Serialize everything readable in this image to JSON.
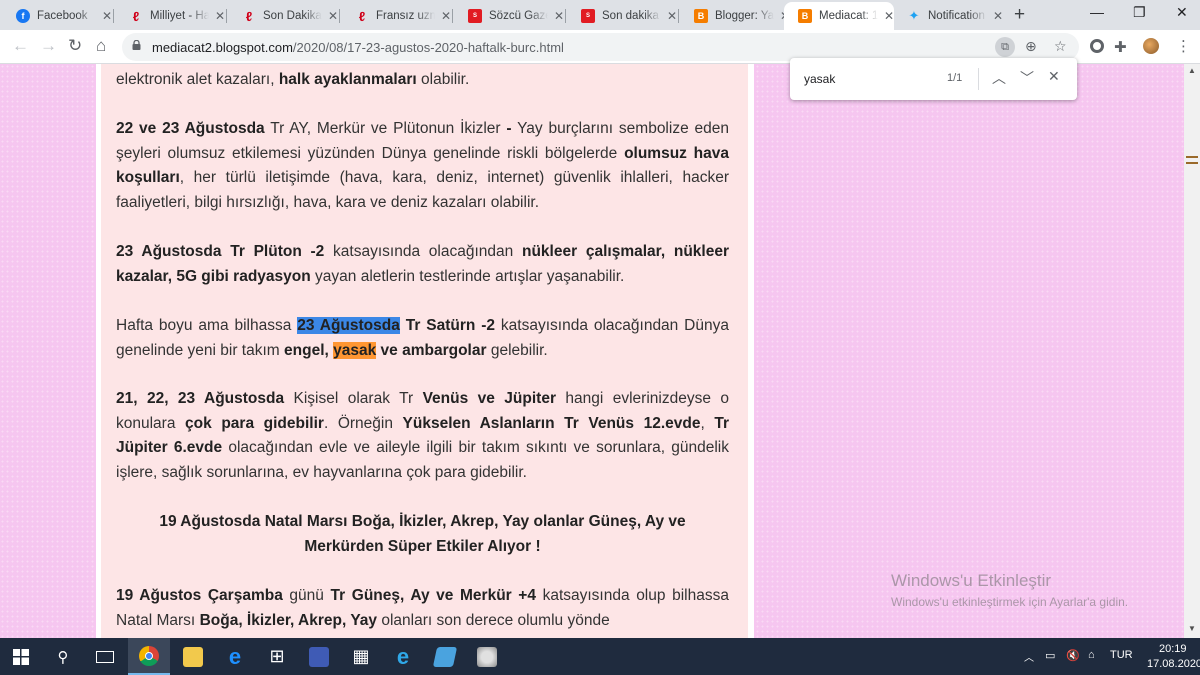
{
  "browser": {
    "tabs": [
      {
        "label": "Facebook",
        "favicon": "facebook-icon",
        "color": "#1877f2"
      },
      {
        "label": "Milliyet - Ha",
        "favicon": "milliyet-icon",
        "color": "#d0021b"
      },
      {
        "label": "Son Dakika",
        "favicon": "milliyet-icon",
        "color": "#d0021b"
      },
      {
        "label": "Fransız uzm",
        "favicon": "milliyet-icon",
        "color": "#d0021b"
      },
      {
        "label": "Sözcü Gaze",
        "favicon": "sozcu-icon",
        "color": "#e11b22"
      },
      {
        "label": "Son dakika",
        "favicon": "sozcu-icon",
        "color": "#e11b22"
      },
      {
        "label": "Blogger: Ya",
        "favicon": "blogger-icon",
        "color": "#f57d00"
      },
      {
        "label": "Mediacat: 1",
        "favicon": "blogger-icon",
        "color": "#f57d00",
        "active": true
      },
      {
        "label": "Notification",
        "favicon": "twitter-icon",
        "color": "#1da1f2"
      }
    ],
    "address": {
      "host": "mediacat2.blogspot.com",
      "path": "/2020/08/17-23-agustos-2020-haftalk-burc.html"
    },
    "find": {
      "query": "yasak",
      "count": "1/1"
    }
  },
  "post": {
    "p0": {
      "line": "elektronik alet kazaları, ",
      "bold": "halk ayaklanmaları",
      "tail": " olabilir."
    },
    "p1": {
      "b1": "22 ve 23 Ağustosda",
      "t1": " Tr AY, Merkür ve Plütonun İkizler ",
      "b2": "-",
      "t2": " Yay burçlarını sembolize eden şeyleri olumsuz etkilemesi yüzünden Dünya genelinde riskli bölgelerde ",
      "b3": "olumsuz hava koşulları",
      "t3": ", her türlü iletişimde (hava, kara, deniz, internet) güvenlik ihlalleri, hacker faaliyetleri, bilgi hırsızlığı, hava, kara ve deniz kazaları olabilir."
    },
    "p2": {
      "b1": "23 Ağustosda Tr Plüton -2",
      "t1": " katsayısında olacağından ",
      "b2": "nükleer çalışmalar, nükleer kazalar, 5G gibi radyasyon",
      "t2": " yayan aletlerin testlerinde artışlar yaşanabilir."
    },
    "p3": {
      "t1": "Hafta boyu ama bilhassa ",
      "sel": "23 Ağustosda",
      "t2": " ",
      "b1": "Tr Satürn -2",
      "t3": " katsayısında olacağından Dünya genelinde yeni bir takım ",
      "b2": "engel, ",
      "find": "yasak",
      "b3": " ve ambargolar",
      "t4": " gelebilir."
    },
    "p4": {
      "b1": "21, 22, 23 Ağustosda",
      "t1": " Kişisel olarak Tr ",
      "b2": "Venüs ve Jüpiter",
      "t2": " hangi evlerinizdeyse o konulara ",
      "b3": "çok para gidebilir",
      "t3": ". Örneğin ",
      "b4": "Yükselen Aslanların Tr Venüs 12.evde",
      "t4": ", ",
      "b5": "Tr Jüpiter 6.evde",
      "t5": " olacağından evle ve aileyle ilgili bir takım sıkıntı ve sorunlara, gündelik işlere, sağlık sorunlarına, ev hayvanlarına çok para gidebilir."
    },
    "p5": {
      "heading": "19 Ağustosda Natal Marsı Boğa, İkizler, Akrep, Yay olanlar Güneş, Ay ve Merkürden Süper Etkiler Alıyor !"
    },
    "p6": {
      "b1": "19 Ağustos Çarşamba",
      "t1": " günü ",
      "b2": "Tr Güneş, Ay ve Merkür +4",
      "t2": " katsayısında olup bilhassa Natal Marsı ",
      "b3": "Boğa, İkizler, Akrep, Yay",
      "t3": " olanları son derece olumlu yönde"
    }
  },
  "watermark": {
    "title": "Windows'u Etkinleştir",
    "subtitle": "Windows'u etkinleştirmek için Ayarlar'a gidin."
  },
  "taskbar": {
    "lang": "TUR",
    "time": "20:19",
    "date": "17.08.2020"
  }
}
